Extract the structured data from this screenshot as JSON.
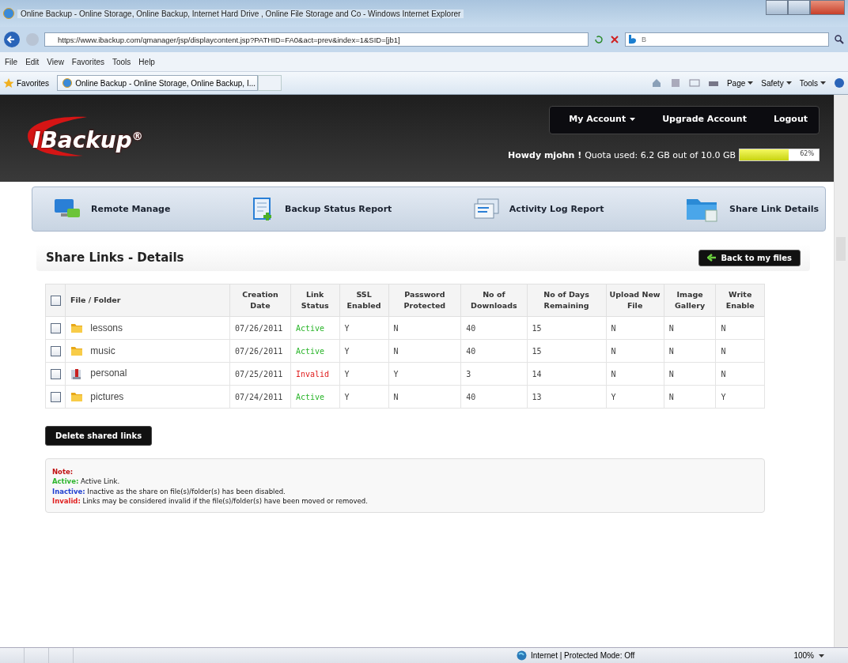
{
  "window": {
    "title": "Online Backup - Online Storage, Online Backup, Internet Hard Drive , Online File Storage and Co - Windows Internet Explorer"
  },
  "address_bar": {
    "url": "https://www.ibackup.com/qmanager/jsp/displaycontent.jsp?PATHID=FA0&act=prev&index=1&SID=[jb1]",
    "search_placeholder": "B"
  },
  "menu": [
    "File",
    "Edit",
    "View",
    "Favorites",
    "Tools",
    "Help"
  ],
  "favorites_bar": {
    "favorites": "Favorites",
    "tab": "Online Backup - Online Storage, Online Backup, I...",
    "commands": [
      "Page",
      "Safety",
      "Tools"
    ]
  },
  "header": {
    "logo": "IBackup",
    "registered": "®",
    "account_menu": [
      {
        "label": "My Account",
        "dropdown": true
      },
      {
        "label": "Upgrade Account",
        "dropdown": false
      },
      {
        "label": "Logout",
        "dropdown": false
      }
    ],
    "greeting": "Howdy mjohn !",
    "quota": "Quota used: 6.2 GB out of 10.0 GB",
    "quota_bar": {
      "level": 0.62,
      "reading": "62%"
    }
  },
  "nav": [
    {
      "label": "Remote Manage",
      "kind": "monitor"
    },
    {
      "label": "Backup Status Report",
      "kind": "report"
    },
    {
      "label": "Activity Log Report",
      "kind": "log"
    },
    {
      "label": "Share Link Details",
      "kind": "folder"
    }
  ],
  "page_title": "Share Links - Details",
  "back_button": "Back to my files",
  "table": {
    "columns": [
      "File / Folder",
      "Creation Date",
      "Link Status",
      "SSL Enabled",
      "Password Protected",
      "No of Downloads",
      "No of Days Remaining",
      "Upload New File",
      "Image Gallery",
      "Write Enable"
    ],
    "header_checked": false,
    "rows": [
      {
        "checked": false,
        "kind": "folder",
        "cells": [
          "lessons",
          "07/26/2011",
          "Active",
          "Y",
          "N",
          "40",
          "15",
          "N",
          "N",
          "N"
        ],
        "color": "#2bb52b"
      },
      {
        "checked": false,
        "kind": "folder",
        "cells": [
          "music",
          "07/26/2011",
          "Active",
          "Y",
          "N",
          "40",
          "15",
          "N",
          "N",
          "N"
        ],
        "color": "#2bb52b"
      },
      {
        "checked": false,
        "kind": "locked",
        "cells": [
          "personal",
          "07/25/2011",
          "Invalid",
          "Y",
          "Y",
          "3",
          "14",
          "N",
          "N",
          "N"
        ],
        "color": "#e02020"
      },
      {
        "checked": false,
        "kind": "folder",
        "cells": [
          "pictures",
          "07/24/2011",
          "Active",
          "Y",
          "N",
          "40",
          "13",
          "Y",
          "N",
          "Y"
        ],
        "color": "#2bb52b"
      }
    ]
  },
  "delete_button": "Delete shared links",
  "note": {
    "title": "Note:",
    "items": [
      {
        "color": "#2bb52b",
        "term": "Active:",
        "text": "Active Link."
      },
      {
        "color": "#2040d0",
        "term": "Inactive:",
        "text": "Inactive as the share on file(s)/folder(s) has been disabled."
      },
      {
        "color": "#e02020",
        "term": "Invalid:",
        "text": "Links may be considered invalid if the file(s)/folder(s) have been moved or removed."
      }
    ]
  },
  "status_bar": {
    "zone": "Internet | Protected Mode: Off",
    "zoom": "100%"
  }
}
